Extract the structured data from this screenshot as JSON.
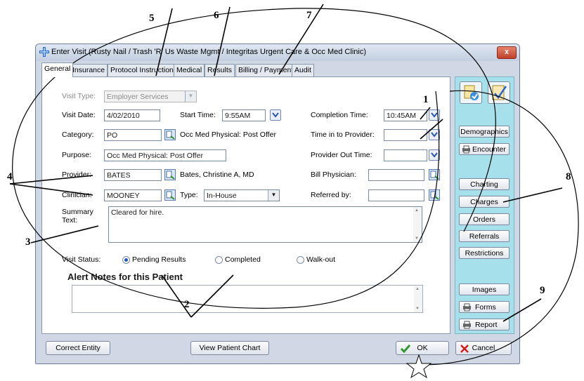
{
  "window": {
    "title": "Enter Visit (Rusty Nail / Trash 'R' Us Waste Mgmt / Integritas Urgent Care & Occ Med Clinic)",
    "close_label": "x"
  },
  "tabs": [
    {
      "label": "General"
    },
    {
      "label": "Insurance"
    },
    {
      "label": "Protocol Instructions"
    },
    {
      "label": "Medical"
    },
    {
      "label": "Results"
    },
    {
      "label": "Billing / Payment"
    },
    {
      "label": "Audit"
    }
  ],
  "form": {
    "visit_type": {
      "label": "Visit Type:",
      "value": "Employer Services"
    },
    "visit_date": {
      "label": "Visit Date:",
      "value": "4/02/2010"
    },
    "start_time": {
      "label": "Start Time:",
      "value": "9:55AM"
    },
    "completion_time": {
      "label": "Completion Time:",
      "value": "10:45AM"
    },
    "category": {
      "label": "Category:",
      "value": "PO",
      "description": "Occ Med Physical: Post Offer"
    },
    "time_in_provider": {
      "label": "Time in to Provider:",
      "value": ""
    },
    "purpose": {
      "label": "Purpose:",
      "value": "Occ Med Physical: Post Offer"
    },
    "provider_out_time": {
      "label": "Provider Out Time:",
      "value": ""
    },
    "provider": {
      "label": "Provider:",
      "value": "BATES",
      "description": "Bates, Christine A, MD"
    },
    "bill_physician": {
      "label": "Bill Physician:",
      "value": ""
    },
    "clinician": {
      "label": "Clinician:",
      "value": "MOONEY"
    },
    "type": {
      "label": "Type:",
      "value": "In-House"
    },
    "referred_by": {
      "label": "Referred by:",
      "value": ""
    },
    "summary": {
      "label_line1": "Summary",
      "label_line2": "Text:",
      "value": "Cleared for hire."
    },
    "visit_status": {
      "label": "Visit Status:",
      "options": [
        "Pending Results",
        "Completed",
        "Walk-out"
      ],
      "selected": "Pending Results"
    },
    "alert_notes_header": "Alert Notes for this Patient"
  },
  "sidebar": {
    "demographics": "Demographics",
    "encounter": "Encounter",
    "charting": "Charting",
    "charges": "Charges",
    "orders": "Orders",
    "referrals": "Referrals",
    "restrictions": "Restrictions",
    "images": "Images",
    "forms": "Forms",
    "report": "Report"
  },
  "footer": {
    "correct_entity": "Correct Entity",
    "view_patient_chart": "View Patient Chart",
    "ok": "OK",
    "cancel": "Cancel"
  },
  "annotations": [
    "1",
    "2",
    "3",
    "4",
    "5",
    "6",
    "7",
    "8",
    "9"
  ],
  "colors": {
    "sidebar_bg": "#a6e0ea",
    "title_close": "#c0412a",
    "ok_check": "#2e9a2e",
    "cancel_x": "#d11a1a"
  }
}
